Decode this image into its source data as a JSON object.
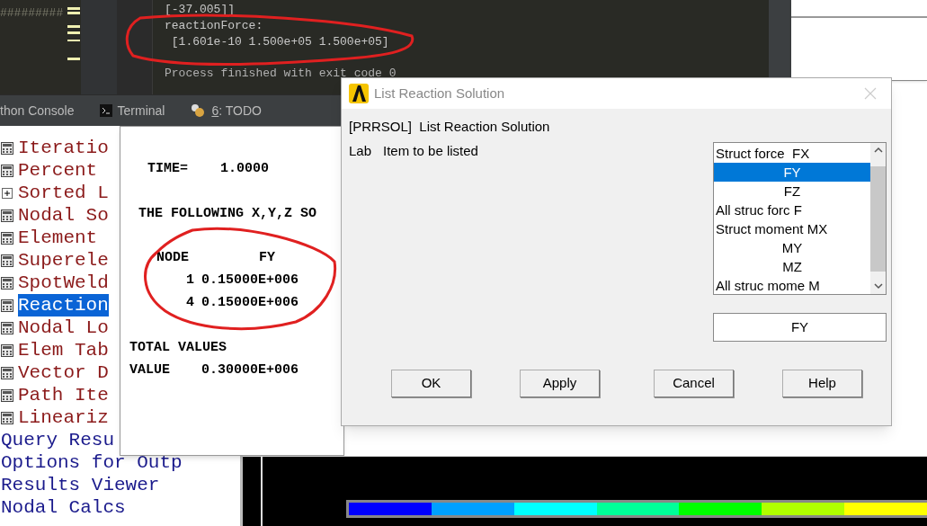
{
  "editor": {
    "fragment": "#########"
  },
  "console": {
    "lines": [
      "[-37.005]]",
      "reactionForce:",
      " [1.601e-10 1.500e+05 1.500e+05]"
    ],
    "status": "Process finished with exit code 0"
  },
  "tool_tabs": [
    {
      "label": "thon Console",
      "kind": "plain"
    },
    {
      "label": "Terminal",
      "kind": "terminal"
    },
    {
      "label": "6: TODO",
      "kind": "todo"
    }
  ],
  "tree": [
    {
      "label": "Iteratio",
      "kind": "table",
      "selected": false
    },
    {
      "label": "Percent",
      "kind": "table",
      "selected": false
    },
    {
      "label": "Sorted L",
      "kind": "group",
      "selected": false,
      "expanded": false
    },
    {
      "label": "Nodal So",
      "kind": "table",
      "selected": false
    },
    {
      "label": "Element",
      "kind": "table",
      "selected": false
    },
    {
      "label": "Superele",
      "kind": "table",
      "selected": false
    },
    {
      "label": "SpotWeld",
      "kind": "table",
      "selected": false
    },
    {
      "label": "Reaction",
      "kind": "table",
      "selected": true
    },
    {
      "label": "Nodal Lo",
      "kind": "table",
      "selected": false
    },
    {
      "label": "Elem Tab",
      "kind": "table",
      "selected": false
    },
    {
      "label": "Vector D",
      "kind": "table",
      "selected": false
    },
    {
      "label": "Path Ite",
      "kind": "table",
      "selected": false
    },
    {
      "label": "Lineariz",
      "kind": "table",
      "selected": false
    },
    {
      "label": "Query Resu",
      "kind": "link",
      "selected": false
    },
    {
      "label": "Options for Outp",
      "kind": "link",
      "selected": false
    },
    {
      "label": "Results Viewer",
      "kind": "link",
      "selected": false
    },
    {
      "label": "Nodal Calcs",
      "kind": "link",
      "selected": false
    }
  ],
  "listing": {
    "time_line": "TIME=    1.0000",
    "heading": "THE FOLLOWING X,Y,Z SO",
    "columns": [
      "NODE",
      "FY"
    ],
    "rows": [
      [
        "1",
        "0.15000E+006"
      ],
      [
        "4",
        "0.15000E+006"
      ]
    ],
    "total_label": "TOTAL VALUES",
    "total": {
      "label": "VALUE",
      "value": "0.30000E+006"
    }
  },
  "dialog": {
    "title": "List Reaction Solution",
    "command": "[PRRSOL]  List Reaction Solution",
    "field_label": "Lab",
    "field_description": "Item to be listed",
    "items": [
      {
        "label": "Struct force  FX",
        "kind": "group",
        "selected": false
      },
      {
        "label": "FY",
        "kind": "component",
        "selected": true
      },
      {
        "label": "FZ",
        "kind": "component",
        "selected": false
      },
      {
        "label": "All struc forc F",
        "kind": "group",
        "selected": false
      },
      {
        "label": "Struct moment MX",
        "kind": "group",
        "selected": false
      },
      {
        "label": "MY",
        "kind": "component",
        "selected": false
      },
      {
        "label": "MZ",
        "kind": "component",
        "selected": false
      },
      {
        "label": "All struc mome M",
        "kind": "group",
        "selected": false
      }
    ],
    "value": "FY",
    "buttons": [
      "OK",
      "Apply",
      "Cancel",
      "Help"
    ]
  },
  "legend": {
    "bands": [
      {
        "color": "#0000ff"
      },
      {
        "color": "#00a0ff"
      },
      {
        "color": "#00ffff"
      },
      {
        "color": "#00ff99"
      },
      {
        "color": "#00ff00"
      },
      {
        "color": "#b0ff00"
      },
      {
        "color": "#ffff00"
      }
    ]
  }
}
